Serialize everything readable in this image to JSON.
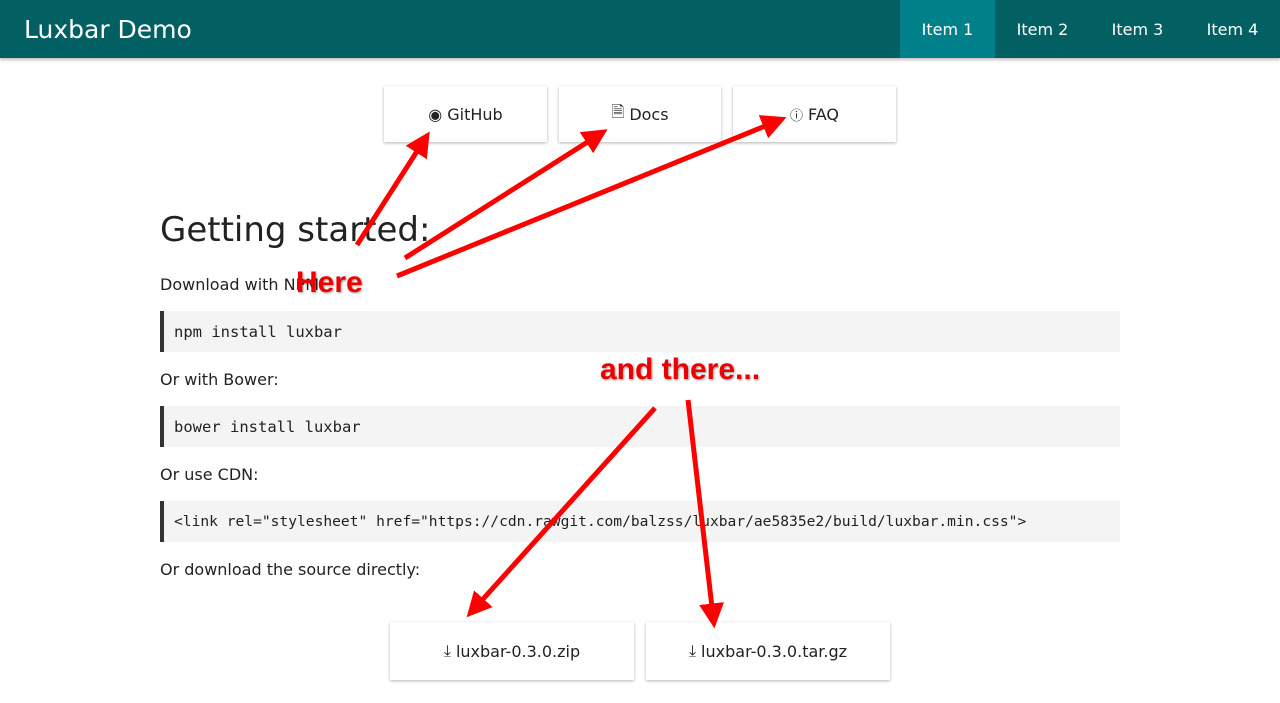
{
  "nav": {
    "brand": "Luxbar Demo",
    "items": [
      {
        "label": "Item 1"
      },
      {
        "label": "Item 2"
      },
      {
        "label": "Item 3"
      },
      {
        "label": "Item 4"
      }
    ]
  },
  "links": [
    {
      "label": "GitHub",
      "icon": "github-icon"
    },
    {
      "label": "Docs",
      "icon": "document-icon"
    },
    {
      "label": "FAQ",
      "icon": "question-circle-icon"
    }
  ],
  "main": {
    "heading": "Getting started:",
    "npm_text": "Download with NPM:",
    "npm_code": "npm install luxbar",
    "bower_text": "Or with Bower:",
    "bower_code": "bower install luxbar",
    "cdn_text": "Or use CDN:",
    "cdn_code": "<link rel=\"stylesheet\" href=\"https://cdn.rawgit.com/balzss/luxbar/ae5835e2/build/luxbar.min.css\">",
    "source_text": "Or download the source directly:"
  },
  "downloads": [
    {
      "label": "luxbar-0.3.0.zip"
    },
    {
      "label": "luxbar-0.3.0.tar.gz"
    }
  ],
  "annotations": {
    "here": "Here",
    "there": "and there...",
    "color": "#ff0000"
  }
}
